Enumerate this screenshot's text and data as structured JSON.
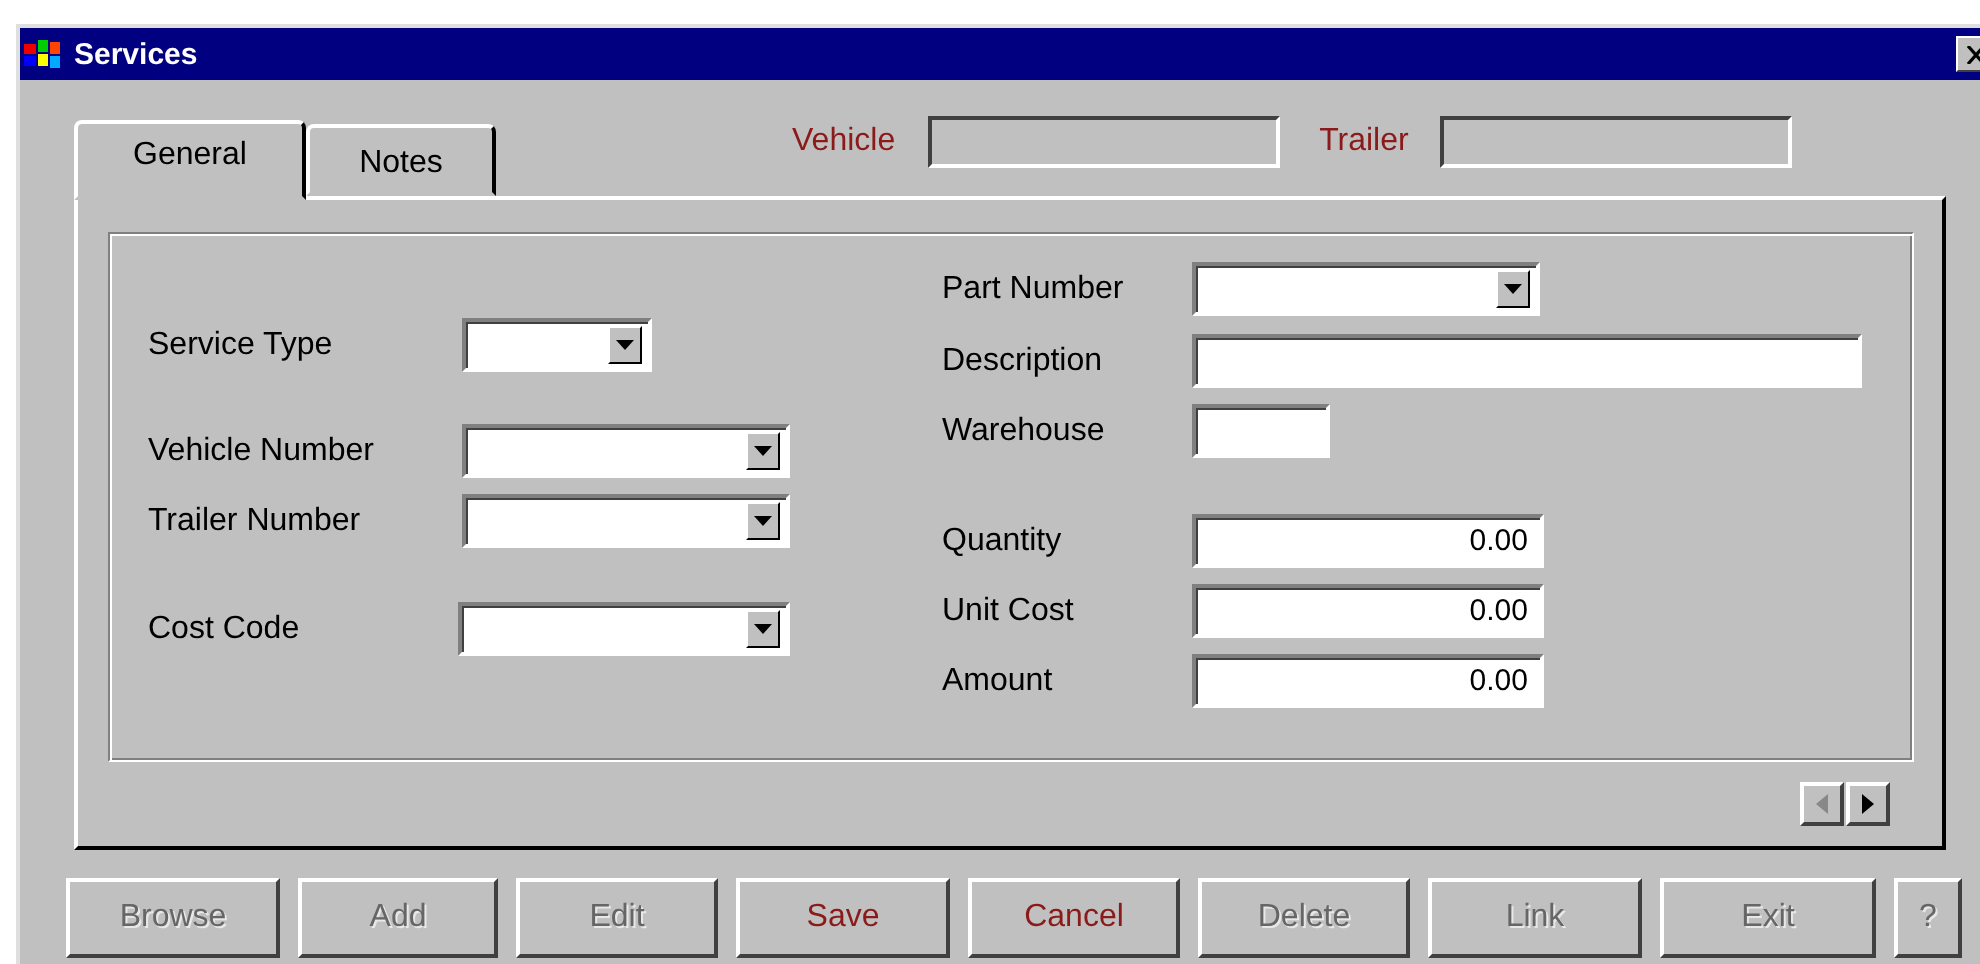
{
  "window": {
    "title": "Services"
  },
  "tabs": [
    {
      "label": "General",
      "selected": true
    },
    {
      "label": "Notes",
      "selected": false
    }
  ],
  "header_fields": [
    {
      "label": "Vehicle"
    },
    {
      "label": "Trailer"
    }
  ],
  "left_fields": [
    {
      "label": "Service Type",
      "kind": "dropdown"
    },
    {
      "label": "Vehicle Number",
      "kind": "dropdown"
    },
    {
      "label": "Trailer Number",
      "kind": "dropdown"
    },
    {
      "label": "Cost Code",
      "kind": "dropdown"
    }
  ],
  "right_fields": [
    {
      "label": "Part Number",
      "kind": "dropdown"
    },
    {
      "label": "Description",
      "kind": "text"
    },
    {
      "label": "Warehouse",
      "kind": "text"
    },
    {
      "label": "Quantity",
      "kind": "number",
      "value": "0.00"
    },
    {
      "label": "Unit Cost",
      "kind": "number",
      "value": "0.00"
    },
    {
      "label": "Amount",
      "kind": "number",
      "value": "0.00"
    }
  ],
  "pager": {
    "previous_disabled": true,
    "next_disabled": false
  },
  "buttons": [
    {
      "label": "Browse",
      "disabled": true
    },
    {
      "label": "Add",
      "disabled": true
    },
    {
      "label": "Edit",
      "disabled": true
    },
    {
      "label": "Save",
      "disabled": false
    },
    {
      "label": "Cancel",
      "disabled": false
    },
    {
      "label": "Delete",
      "disabled": true
    },
    {
      "label": "Link",
      "disabled": true
    },
    {
      "label": "Exit",
      "disabled": true
    },
    {
      "label": "?",
      "disabled": true
    }
  ]
}
